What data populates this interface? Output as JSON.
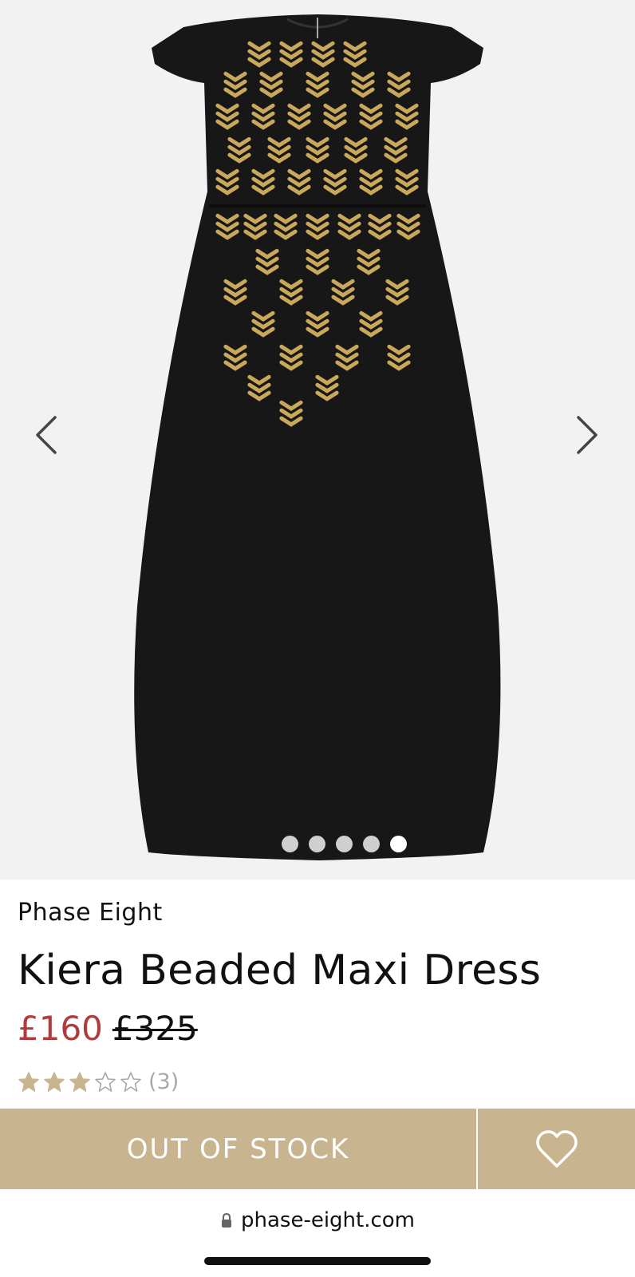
{
  "gallery": {
    "image_alt": "Black beaded maxi dress with gold embellishment",
    "prev_icon": "chevron-left-icon",
    "next_icon": "chevron-right-icon",
    "slides_total": 5,
    "active_slide": 5
  },
  "product": {
    "brand": "Phase Eight",
    "name": "Kiera Beaded Maxi Dress",
    "price_now": "£160",
    "price_was": "£325",
    "price_now_color": "#b2393c",
    "rating": 3,
    "rating_max": 5,
    "rating_count": "(3)"
  },
  "actions": {
    "stock_label": "OUT OF STOCK",
    "wishlist_icon": "heart-icon",
    "accent_color": "#c8b48e"
  },
  "browser": {
    "url": "phase-eight.com",
    "lock_icon": "lock-icon"
  }
}
